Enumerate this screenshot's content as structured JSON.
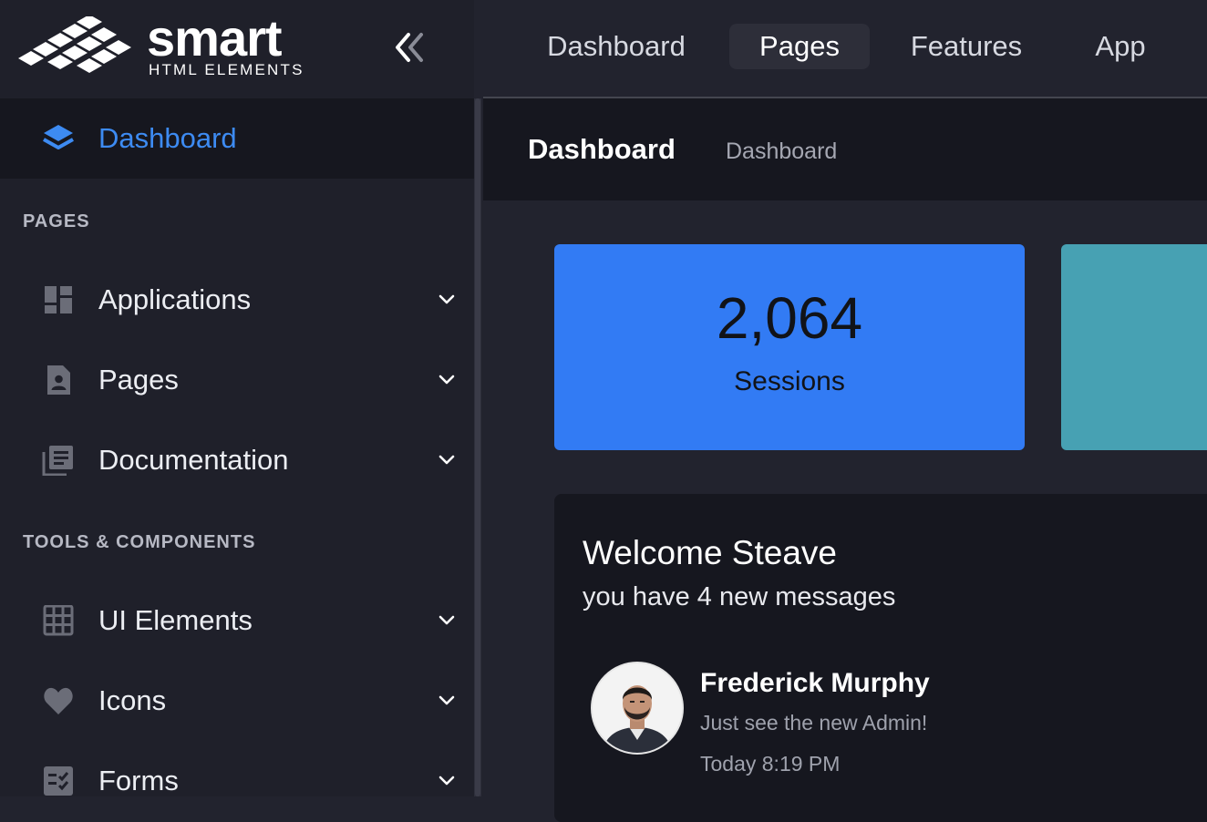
{
  "brand": {
    "name": "smart",
    "subtitle": "HTML ELEMENTS",
    "logo_icon": "diamond-grid-logo",
    "collapse_icon": "chevrons-left-icon"
  },
  "top_nav": {
    "tabs": [
      {
        "label": "Dashboard",
        "active": false
      },
      {
        "label": "Pages",
        "active": true
      },
      {
        "label": "Features",
        "active": false
      },
      {
        "label": "App",
        "active": false
      }
    ]
  },
  "sidebar": {
    "active_item": {
      "label": "Dashboard",
      "icon": "layers-icon"
    },
    "sections": [
      {
        "title": "PAGES",
        "items": [
          {
            "label": "Applications",
            "icon": "dashboard-grid-icon"
          },
          {
            "label": "Pages",
            "icon": "contact-page-icon"
          },
          {
            "label": "Documentation",
            "icon": "library-books-icon"
          }
        ]
      },
      {
        "title": "TOOLS & COMPONENTS",
        "items": [
          {
            "label": "UI Elements",
            "icon": "grid-icon"
          },
          {
            "label": "Icons",
            "icon": "heart-icon"
          },
          {
            "label": "Forms",
            "icon": "checklist-icon"
          }
        ]
      }
    ]
  },
  "header": {
    "title": "Dashboard",
    "breadcrumb": "Dashboard"
  },
  "stats": [
    {
      "value": "2,064",
      "label": "Sessions",
      "color": "#327bf4"
    },
    {
      "value": "",
      "label": "",
      "color": "#47a1b3"
    }
  ],
  "welcome": {
    "title": "Welcome Steave",
    "subtitle": "you have 4 new messages",
    "message": {
      "name": "Frederick Murphy",
      "text": "Just see the new Admin!",
      "time": "Today 8:19 PM"
    }
  },
  "colors": {
    "accent": "#3d8bf2",
    "sidebar_bg": "#1f202a",
    "content_bg": "#22232e",
    "panel_bg": "#16171f"
  }
}
